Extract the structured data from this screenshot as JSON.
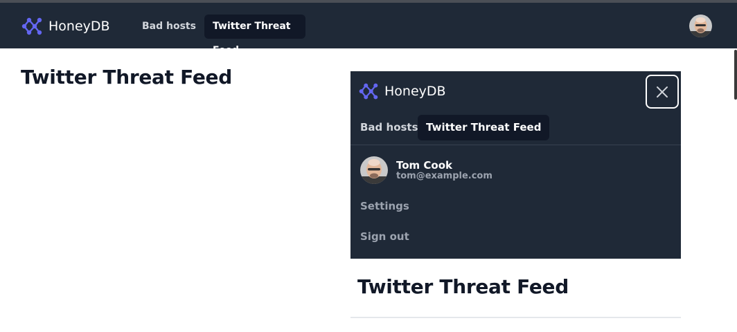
{
  "navbar": {
    "brand": "HoneyDB",
    "links": [
      {
        "label": "Bad hosts",
        "active": false
      },
      {
        "label": "Twitter Threat Feed",
        "active": true
      }
    ],
    "avatar_icon": "user-avatar"
  },
  "main": {
    "title": "Twitter Threat Feed"
  },
  "mobile_menu": {
    "brand": "HoneyDB",
    "close_icon": "close-icon",
    "links": [
      {
        "label": "Bad hosts",
        "active": false
      },
      {
        "label": "Twitter Threat Feed",
        "active": true
      }
    ],
    "user": {
      "name": "Tom Cook",
      "email": "tom@example.com"
    },
    "items": [
      {
        "label": "Settings"
      },
      {
        "label": "Sign out"
      }
    ],
    "section_title": "Twitter Threat Feed"
  },
  "colors": {
    "navbar_bg": "#1f2937",
    "active_bg": "#111827",
    "logo_accent": "#6366f1"
  }
}
